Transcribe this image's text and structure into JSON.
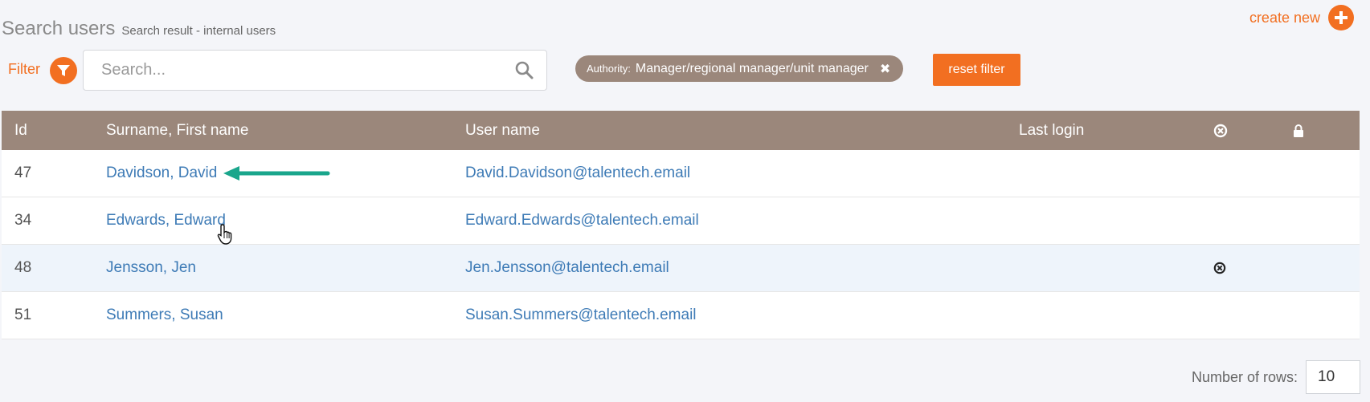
{
  "header": {
    "create_new": "create new",
    "title": "Search users",
    "subtitle": "Search result - internal users"
  },
  "filter": {
    "label": "Filter",
    "search_placeholder": "Search...",
    "chip_key": "Authority:",
    "chip_value": "Manager/regional manager/unit manager",
    "reset_label": "reset filter"
  },
  "table": {
    "columns": {
      "id": "Id",
      "name": "Surname, First name",
      "username": "User name",
      "last_login": "Last login"
    },
    "header_icons": [
      "remove-circle-icon",
      "lock-icon"
    ],
    "rows": [
      {
        "id": "47",
        "name": "Davidson, David",
        "username": "David.Davidson@talentech.email",
        "last_login": "",
        "removed": false
      },
      {
        "id": "34",
        "name": "Edwards, Edward",
        "username": "Edward.Edwards@talentech.email",
        "last_login": "",
        "removed": false
      },
      {
        "id": "48",
        "name": "Jensson, Jen",
        "username": "Jen.Jensson@talentech.email",
        "last_login": "",
        "removed": true
      },
      {
        "id": "51",
        "name": "Summers, Susan",
        "username": "Susan.Summers@talentech.email",
        "last_login": "",
        "removed": false
      }
    ]
  },
  "pagination": {
    "rows_label": "Number of rows:",
    "rows_value": "10"
  },
  "colors": {
    "accent": "#f26f21",
    "table_header": "#9b877b",
    "link": "#3e7bb6",
    "arrow": "#1aa68c"
  }
}
